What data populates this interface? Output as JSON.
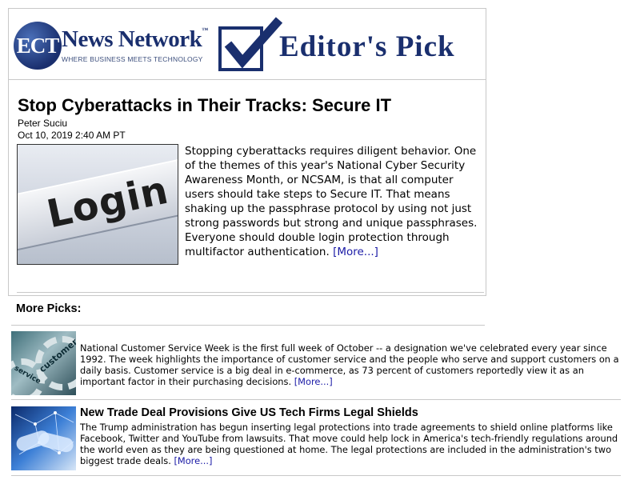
{
  "header": {
    "logo_mark": "ECT",
    "logo_name": "News Network",
    "logo_tm": "™",
    "logo_tagline": "WHERE BUSINESS MEETS TECHNOLOGY",
    "banner": "Editor's Pick",
    "brand_color": "#1a2f6e"
  },
  "featured": {
    "title": "Stop Cyberattacks in Their Tracks: Secure IT",
    "author": "Peter Suciu",
    "date": "Oct 10, 2019 2:40 AM PT",
    "image_word": "Login",
    "body": "Stopping cyberattacks requires diligent behavior. One of the themes of this year's National Cyber Security Awareness Month, or NCSAM, is that all computer users should take steps to Secure IT. That means shaking up the passphrase protocol by using not just strong passwords but strong and unique passphrases. Everyone should double login protection through multifactor authentication.",
    "more_link": "[More...]"
  },
  "more_picks": {
    "heading": "More Picks:",
    "items": [
      {
        "title": "",
        "image_words": [
          "customer",
          "service"
        ],
        "body": "National Customer Service Week is the first full week of October -- a designation we've celebrated every year since 1992. The week highlights the importance of customer service and the people who serve and support customers on a daily basis. Customer service is a big deal in e-commerce, as 73 percent of customers reportedly view it as an important factor in their purchasing decisions.",
        "more_link": "[More...]"
      },
      {
        "title": "New Trade Deal Provisions Give US Tech Firms Legal Shields",
        "body": "The Trump administration has begun inserting legal protections into trade agreements to shield online platforms like Facebook, Twitter and YouTube from lawsuits. That move could help lock in America's tech-friendly regulations around the world even as they are being questioned at home. The legal protections are included in the administration's two biggest trade deals.",
        "more_link": "[More...]"
      }
    ]
  },
  "link_color": "#1a1aa6"
}
